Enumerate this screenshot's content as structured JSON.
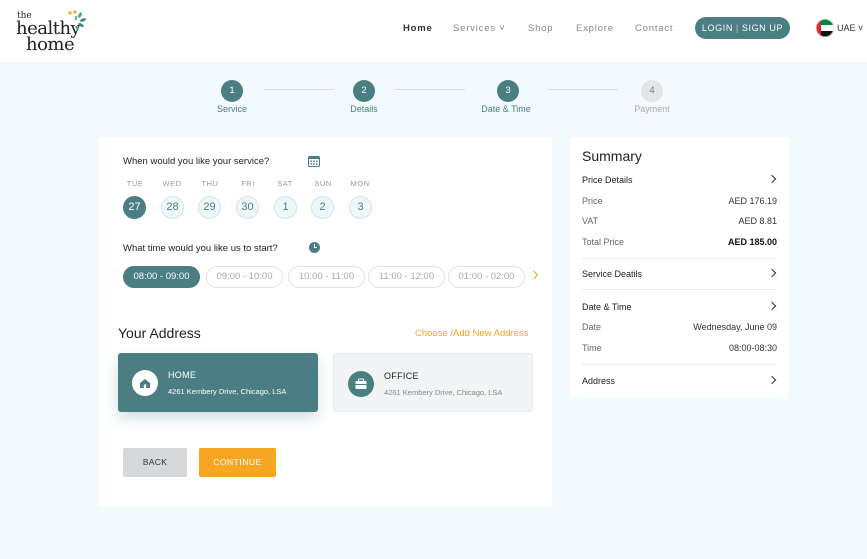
{
  "brand": {
    "logo_line1": "the",
    "logo_line2": "healthy",
    "logo_line3": "home"
  },
  "nav": {
    "items": [
      {
        "label": "Home",
        "active": true
      },
      {
        "label": "Services ˅",
        "active": false
      },
      {
        "label": "Shop",
        "active": false
      },
      {
        "label": "Explore",
        "active": false
      },
      {
        "label": "Contact",
        "active": false
      }
    ],
    "login_label": "LOGIN",
    "signup_label": "SIGN UP",
    "region_label": "UAE ˅"
  },
  "stepper": {
    "steps": [
      {
        "number": "1",
        "label": "Service",
        "completed": true
      },
      {
        "number": "2",
        "label": "Details",
        "completed": true
      },
      {
        "number": "3",
        "label": "Date & Time",
        "completed": true
      },
      {
        "number": "4",
        "label": "Payment",
        "completed": false
      }
    ]
  },
  "schedule": {
    "date_question": "When would you like your service?",
    "time_question": "What time would you like us to start?",
    "days": [
      {
        "day": "TUE",
        "date": "27",
        "selected": true
      },
      {
        "day": "WED",
        "date": "28",
        "selected": false
      },
      {
        "day": "THU",
        "date": "29",
        "selected": false
      },
      {
        "day": "FRI",
        "date": "30",
        "selected": false
      },
      {
        "day": "SAT",
        "date": "1",
        "selected": false
      },
      {
        "day": "SUN",
        "date": "2",
        "selected": false
      },
      {
        "day": "MON",
        "date": "3",
        "selected": false
      }
    ],
    "slots": [
      {
        "label": "08:00 - 09:00",
        "selected": true
      },
      {
        "label": "09:00 - 10:00",
        "selected": false
      },
      {
        "label": "10:00 - 11:00",
        "selected": false
      },
      {
        "label": "11:00 - 12:00",
        "selected": false
      },
      {
        "label": "01:00 - 02:00",
        "selected": false
      }
    ]
  },
  "address": {
    "title": "Your Address",
    "link": "Choose /Add New Address",
    "cards": [
      {
        "name": "HOME",
        "line": "4261 Kembery Drive, Chicago, LSA",
        "selected": true
      },
      {
        "name": "OFFICE",
        "line": "4261 Kembery Drive, Chicago, LSA",
        "selected": false
      }
    ]
  },
  "actions": {
    "back": "BACK",
    "continue": "CONTINUE"
  },
  "summary": {
    "title": "Summary",
    "price_details": "Price Details",
    "price_label": "Price",
    "price_value": "AED 176.19",
    "vat_label": "VAT",
    "vat_value": "AED 8.81",
    "total_label": "Total Price",
    "total_value": "AED 185.00",
    "service_details": "Service Deatils",
    "datetime_head": "Date & Time",
    "date_label": "Date",
    "date_value": "Wednesday, June 09",
    "time_label": "Time",
    "time_value": "08:00-08:30",
    "address_head": "Address"
  },
  "colors": {
    "primary": "#4a7e83",
    "accent": "#f5a623",
    "background": "#f2fafd"
  }
}
